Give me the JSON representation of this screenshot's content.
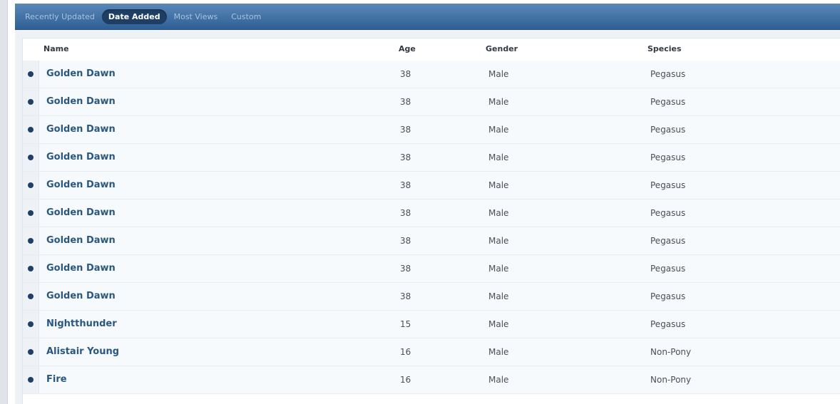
{
  "tabs": [
    {
      "label": "Recently Updated",
      "active": false
    },
    {
      "label": "Date Added",
      "active": true
    },
    {
      "label": "Most Views",
      "active": false
    },
    {
      "label": "Custom",
      "active": false
    }
  ],
  "table": {
    "columns": {
      "name": "Name",
      "age": "Age",
      "gender": "Gender",
      "species": "Species"
    },
    "rows": [
      {
        "name": "Golden Dawn",
        "age": "38",
        "gender": "Male",
        "species": "Pegasus"
      },
      {
        "name": "Golden Dawn",
        "age": "38",
        "gender": "Male",
        "species": "Pegasus"
      },
      {
        "name": "Golden Dawn",
        "age": "38",
        "gender": "Male",
        "species": "Pegasus"
      },
      {
        "name": "Golden Dawn",
        "age": "38",
        "gender": "Male",
        "species": "Pegasus"
      },
      {
        "name": "Golden Dawn",
        "age": "38",
        "gender": "Male",
        "species": "Pegasus"
      },
      {
        "name": "Golden Dawn",
        "age": "38",
        "gender": "Male",
        "species": "Pegasus"
      },
      {
        "name": "Golden Dawn",
        "age": "38",
        "gender": "Male",
        "species": "Pegasus"
      },
      {
        "name": "Golden Dawn",
        "age": "38",
        "gender": "Male",
        "species": "Pegasus"
      },
      {
        "name": "Golden Dawn",
        "age": "38",
        "gender": "Male",
        "species": "Pegasus"
      },
      {
        "name": "Nightthunder",
        "age": "15",
        "gender": "Male",
        "species": "Pegasus"
      },
      {
        "name": "Alistair Young",
        "age": "16",
        "gender": "Male",
        "species": "Non-Pony"
      },
      {
        "name": "Fire",
        "age": "16",
        "gender": "Male",
        "species": "Non-Pony"
      }
    ]
  },
  "colors": {
    "tab_bar": "#2e5f95",
    "active_tab": "#1f3e63",
    "name_link": "#2a5780",
    "bullet": "#1f3f66"
  },
  "icons": {
    "row_bullet": "bullet-icon"
  }
}
